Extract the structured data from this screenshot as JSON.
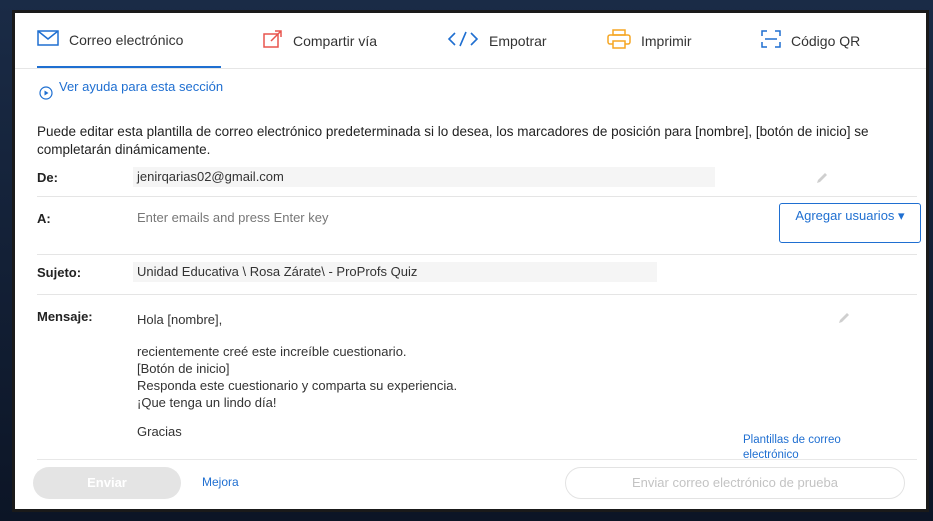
{
  "tabs": [
    {
      "label": "Correo electrónico",
      "icon": "envelope-icon"
    },
    {
      "label": "Compartir vía",
      "icon": "share-icon"
    },
    {
      "label": "Empotrar",
      "icon": "code-icon"
    },
    {
      "label": "Imprimir",
      "icon": "printer-icon"
    },
    {
      "label": "Código QR",
      "icon": "qr-icon"
    }
  ],
  "help": {
    "label": "Ver ayuda para esta sección",
    "icon": "play-circle-icon"
  },
  "intro": "Puede editar esta plantilla de correo electrónico predeterminada si lo desea, los marcadores de posición para [nombre], [botón de inicio] se completarán dinámicamente.",
  "form": {
    "from_label": "De:",
    "from_value": "jenirqarias02@gmail.com",
    "to_label": "A:",
    "to_placeholder": "Enter emails and press Enter key",
    "add_users_label": "Agregar usuarios ▾",
    "subject_label": "Sujeto:",
    "subject_value": "Unidad Educativa \\ Rosa Zárate\\  - ProProfs Quiz",
    "message_label": "Mensaje:",
    "message_lines": [
      "Hola [nombre],",
      "recientemente creé este increíble cuestionario.",
      "[Botón de inicio]",
      "Responda este cuestionario y comparta su experiencia.",
      "¡Que tenga un lindo día!",
      "Gracias"
    ]
  },
  "templates_link": "Plantillas de correo electrónico",
  "footer": {
    "send_label": "Enviar",
    "improve_label": "Mejora",
    "test_label": "Enviar correo electrónico de prueba"
  },
  "colors": {
    "accent": "#1f6fd1",
    "orange": "#f5a623",
    "pink": "#e8554e"
  }
}
